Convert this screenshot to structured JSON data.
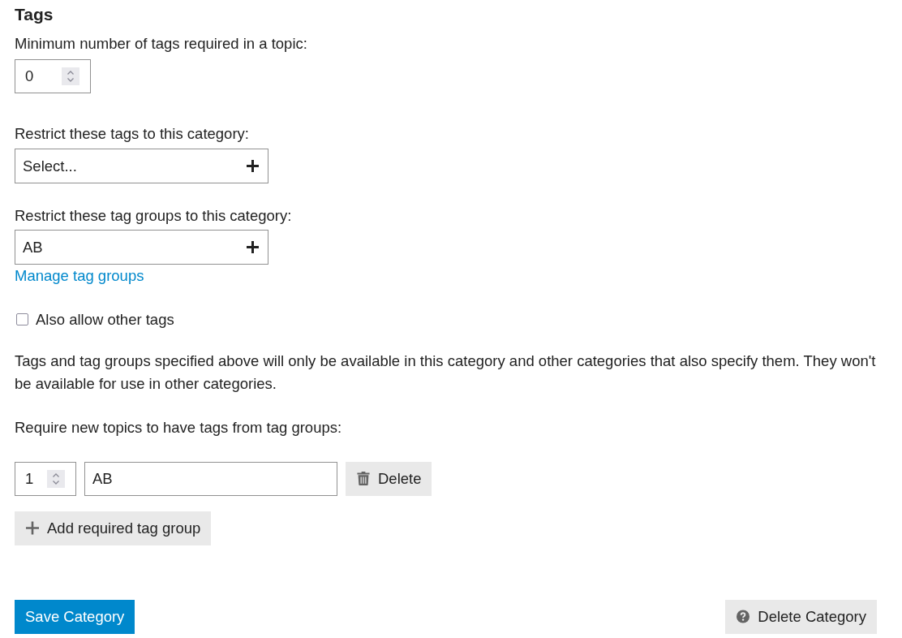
{
  "section_title": "Tags",
  "minimum_tags": {
    "label": "Minimum number of tags required in a topic:",
    "value": "0"
  },
  "restrict_tags": {
    "label": "Restrict these tags to this category:",
    "placeholder": "Select..."
  },
  "restrict_tag_groups": {
    "label": "Restrict these tag groups to this category:",
    "value": "AB",
    "link": "Manage tag groups"
  },
  "allow_other_tags": {
    "label": "Also allow other tags",
    "checked": false
  },
  "description": "Tags and tag groups specified above will only be available in this category and other categories that also specify them. They won't be available for use in other categories.",
  "required_tag_groups": {
    "label": "Require new topics to have tags from tag groups:",
    "rows": [
      {
        "count": "1",
        "group": "AB",
        "delete_label": "Delete"
      }
    ],
    "add_label": "Add required tag group"
  },
  "actions": [
    {
      "kind": "primary",
      "label": "Save Category"
    },
    {
      "kind": "danger",
      "label": "Delete Category"
    }
  ]
}
